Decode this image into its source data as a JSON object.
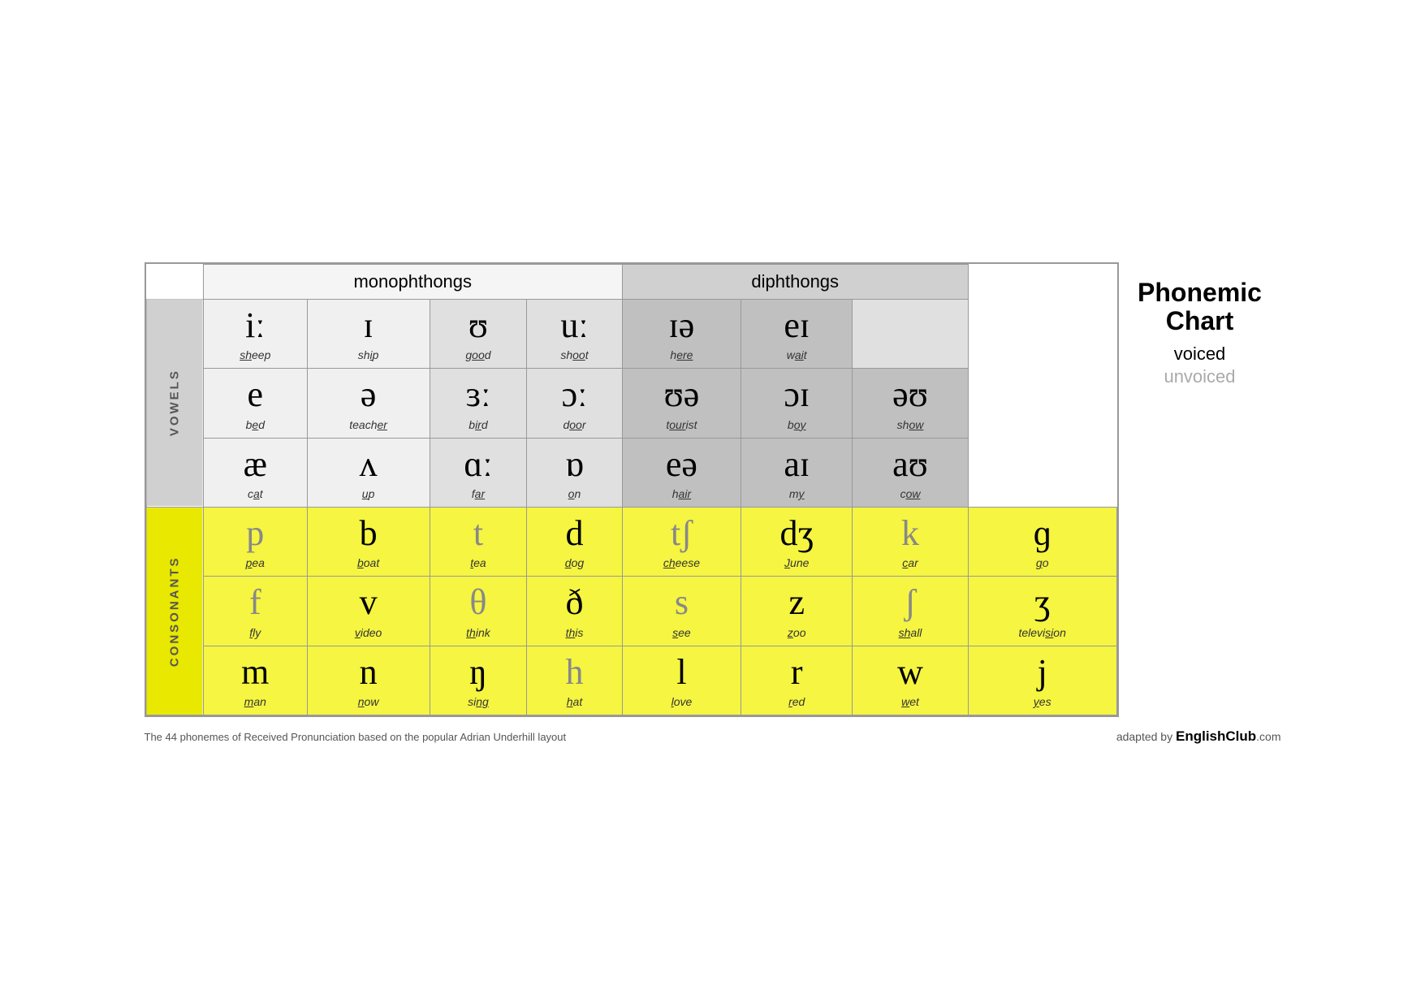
{
  "title": "Phonemic Chart",
  "legend": {
    "title": "Phonemic\nChart",
    "voiced": "voiced",
    "unvoiced": "unvoiced"
  },
  "headers": {
    "monophthongs": "monophthongs",
    "diphthongs": "diphthongs"
  },
  "sections": {
    "vowels": "VOWELS",
    "consonants": "CONSONANTS"
  },
  "footer": {
    "left": "The 44 phonemes of Received Pronunciation based on the popular Adrian Underhill layout",
    "right_prefix": "adapted by ",
    "right_brand": "EnglishClub",
    "right_suffix": ".com"
  },
  "vowel_rows": [
    [
      {
        "symbol": "iː",
        "word": "sheep",
        "underline": "sh",
        "underline_part": "ee"
      },
      {
        "symbol": "ɪ",
        "word": "ship",
        "underline_part": "i"
      },
      {
        "symbol": "ʊ",
        "word": "good",
        "underline_part": "oo"
      },
      {
        "symbol": "uː",
        "word": "shoot",
        "underline_part": "oo"
      },
      {
        "symbol": "ɪə",
        "word": "here",
        "underline_part": "ere"
      },
      {
        "symbol": "eɪ",
        "word": "wait",
        "underline_part": "ai"
      }
    ],
    [
      {
        "symbol": "e",
        "word": "bed",
        "underline_part": "e"
      },
      {
        "symbol": "ə",
        "word": "teacher",
        "underline_part": "er"
      },
      {
        "symbol": "ɜː",
        "word": "bird",
        "underline_part": "ir"
      },
      {
        "symbol": "ɔː",
        "word": "door",
        "underline_part": "oo"
      },
      {
        "symbol": "ʊə",
        "word": "tourist",
        "underline_part": "our"
      },
      {
        "symbol": "ɔɪ",
        "word": "boy",
        "underline_part": "oy"
      },
      {
        "symbol": "əʊ",
        "word": "show",
        "underline_part": "ow"
      }
    ],
    [
      {
        "symbol": "æ",
        "word": "cat",
        "underline_part": "a"
      },
      {
        "symbol": "ʌ",
        "word": "up",
        "underline_part": "u"
      },
      {
        "symbol": "ɑː",
        "word": "far",
        "underline_part": "ar"
      },
      {
        "symbol": "ɒ",
        "word": "on",
        "underline_part": "o"
      },
      {
        "symbol": "eə",
        "word": "hair",
        "underline_part": "air"
      },
      {
        "symbol": "aɪ",
        "word": "my",
        "underline_part": "y"
      },
      {
        "symbol": "aʊ",
        "word": "cow",
        "underline_part": "ow"
      }
    ]
  ],
  "consonant_rows": [
    [
      {
        "symbol": "p",
        "word": "pea",
        "underline_part": "p"
      },
      {
        "symbol": "b",
        "word": "boat",
        "underline_part": "b"
      },
      {
        "symbol": "t",
        "word": "tea",
        "underline_part": "t"
      },
      {
        "symbol": "d",
        "word": "dog",
        "underline_part": "d"
      },
      {
        "symbol": "tʃ",
        "word": "cheese",
        "underline_part": "ch"
      },
      {
        "symbol": "dʒ",
        "word": "June",
        "underline_part": "J"
      },
      {
        "symbol": "k",
        "word": "car",
        "underline_part": "c"
      },
      {
        "symbol": "ɡ",
        "word": "go",
        "underline_part": "g"
      }
    ],
    [
      {
        "symbol": "f",
        "word": "fly",
        "underline_part": "f"
      },
      {
        "symbol": "v",
        "word": "video",
        "underline_part": "v"
      },
      {
        "symbol": "θ",
        "word": "think",
        "underline_part": "th"
      },
      {
        "symbol": "ð",
        "word": "this",
        "underline_part": "th"
      },
      {
        "symbol": "s",
        "word": "see",
        "underline_part": "s"
      },
      {
        "symbol": "z",
        "word": "zoo",
        "underline_part": "z"
      },
      {
        "symbol": "ʃ",
        "word": "shall",
        "underline_part": "sh"
      },
      {
        "symbol": "ʒ",
        "word": "television",
        "underline_part": "si"
      }
    ],
    [
      {
        "symbol": "m",
        "word": "man",
        "underline_part": "m"
      },
      {
        "symbol": "n",
        "word": "now",
        "underline_part": "n"
      },
      {
        "symbol": "ŋ",
        "word": "sing",
        "underline_part": "ng"
      },
      {
        "symbol": "h",
        "word": "hat",
        "underline_part": "h"
      },
      {
        "symbol": "l",
        "word": "love",
        "underline_part": "l"
      },
      {
        "symbol": "r",
        "word": "red",
        "underline_part": "r"
      },
      {
        "symbol": "w",
        "word": "wet",
        "underline_part": "w"
      },
      {
        "symbol": "j",
        "word": "yes",
        "underline_part": "y"
      }
    ]
  ]
}
